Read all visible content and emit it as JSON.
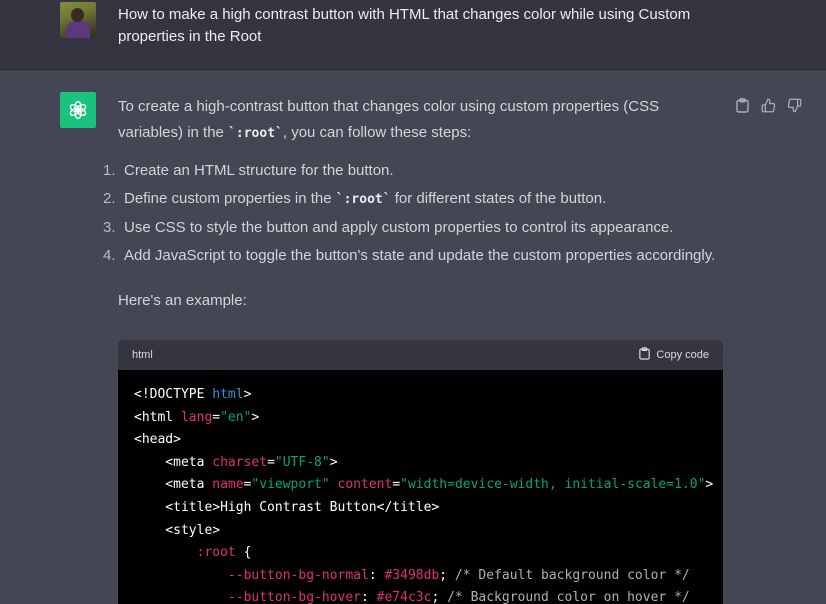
{
  "user_message": {
    "text": "How to make a high contrast button with HTML that changes color while using Custom properties in the Root"
  },
  "assistant": {
    "intro_prefix": "To create a high-contrast button that changes color using custom properties (CSS variables) in the ",
    "intro_code": "`:root`",
    "intro_suffix": ", you can follow these steps:",
    "steps": [
      {
        "num": "1.",
        "text": "Create an HTML structure for the button."
      },
      {
        "num": "2.",
        "text_before": "Define custom properties in the ",
        "code": "`:root`",
        "text_after": " for different states of the button."
      },
      {
        "num": "3.",
        "text": "Use CSS to style the button and apply custom properties to control its appearance."
      },
      {
        "num": "4.",
        "text": "Add JavaScript to toggle the button's state and update the custom properties accordingly."
      }
    ],
    "example_label": "Here's an example:"
  },
  "code_block": {
    "language": "html",
    "copy_label": "Copy code",
    "lines": [
      [
        {
          "t": "<!DOCTYPE ",
          "c": ""
        },
        {
          "t": "html",
          "c": "t-kw"
        },
        {
          "t": ">",
          "c": ""
        }
      ],
      [
        {
          "t": "<html ",
          "c": ""
        },
        {
          "t": "lang",
          "c": "t-attr"
        },
        {
          "t": "=",
          "c": ""
        },
        {
          "t": "\"en\"",
          "c": "t-str"
        },
        {
          "t": ">",
          "c": ""
        }
      ],
      [
        {
          "t": "<head>",
          "c": ""
        }
      ],
      [
        {
          "t": "    <meta ",
          "c": ""
        },
        {
          "t": "charset",
          "c": "t-attr"
        },
        {
          "t": "=",
          "c": ""
        },
        {
          "t": "\"UTF-8\"",
          "c": "t-str"
        },
        {
          "t": ">",
          "c": ""
        }
      ],
      [
        {
          "t": "    <meta ",
          "c": ""
        },
        {
          "t": "name",
          "c": "t-attr"
        },
        {
          "t": "=",
          "c": ""
        },
        {
          "t": "\"viewport\"",
          "c": "t-str"
        },
        {
          "t": " ",
          "c": ""
        },
        {
          "t": "content",
          "c": "t-attr"
        },
        {
          "t": "=",
          "c": ""
        },
        {
          "t": "\"width=device-width, initial-scale=1.0\"",
          "c": "t-str"
        },
        {
          "t": ">",
          "c": ""
        }
      ],
      [
        {
          "t": "    <title>High Contrast Button</title>",
          "c": ""
        }
      ],
      [
        {
          "t": "    <style>",
          "c": ""
        }
      ],
      [
        {
          "t": "        ",
          "c": ""
        },
        {
          "t": ":root",
          "c": "t-sel"
        },
        {
          "t": " {",
          "c": ""
        }
      ],
      [
        {
          "t": "            ",
          "c": ""
        },
        {
          "t": "--button-bg-normal",
          "c": "t-prop"
        },
        {
          "t": ": ",
          "c": ""
        },
        {
          "t": "#3498db",
          "c": "t-val"
        },
        {
          "t": "; ",
          "c": ""
        },
        {
          "t": "/* Default background color */",
          "c": "t-com"
        }
      ],
      [
        {
          "t": "            ",
          "c": ""
        },
        {
          "t": "--button-bg-hover",
          "c": "t-prop"
        },
        {
          "t": ": ",
          "c": ""
        },
        {
          "t": "#e74c3c",
          "c": "t-val"
        },
        {
          "t": "; ",
          "c": ""
        },
        {
          "t": "/* Background color on hover */",
          "c": "t-com"
        }
      ]
    ]
  }
}
